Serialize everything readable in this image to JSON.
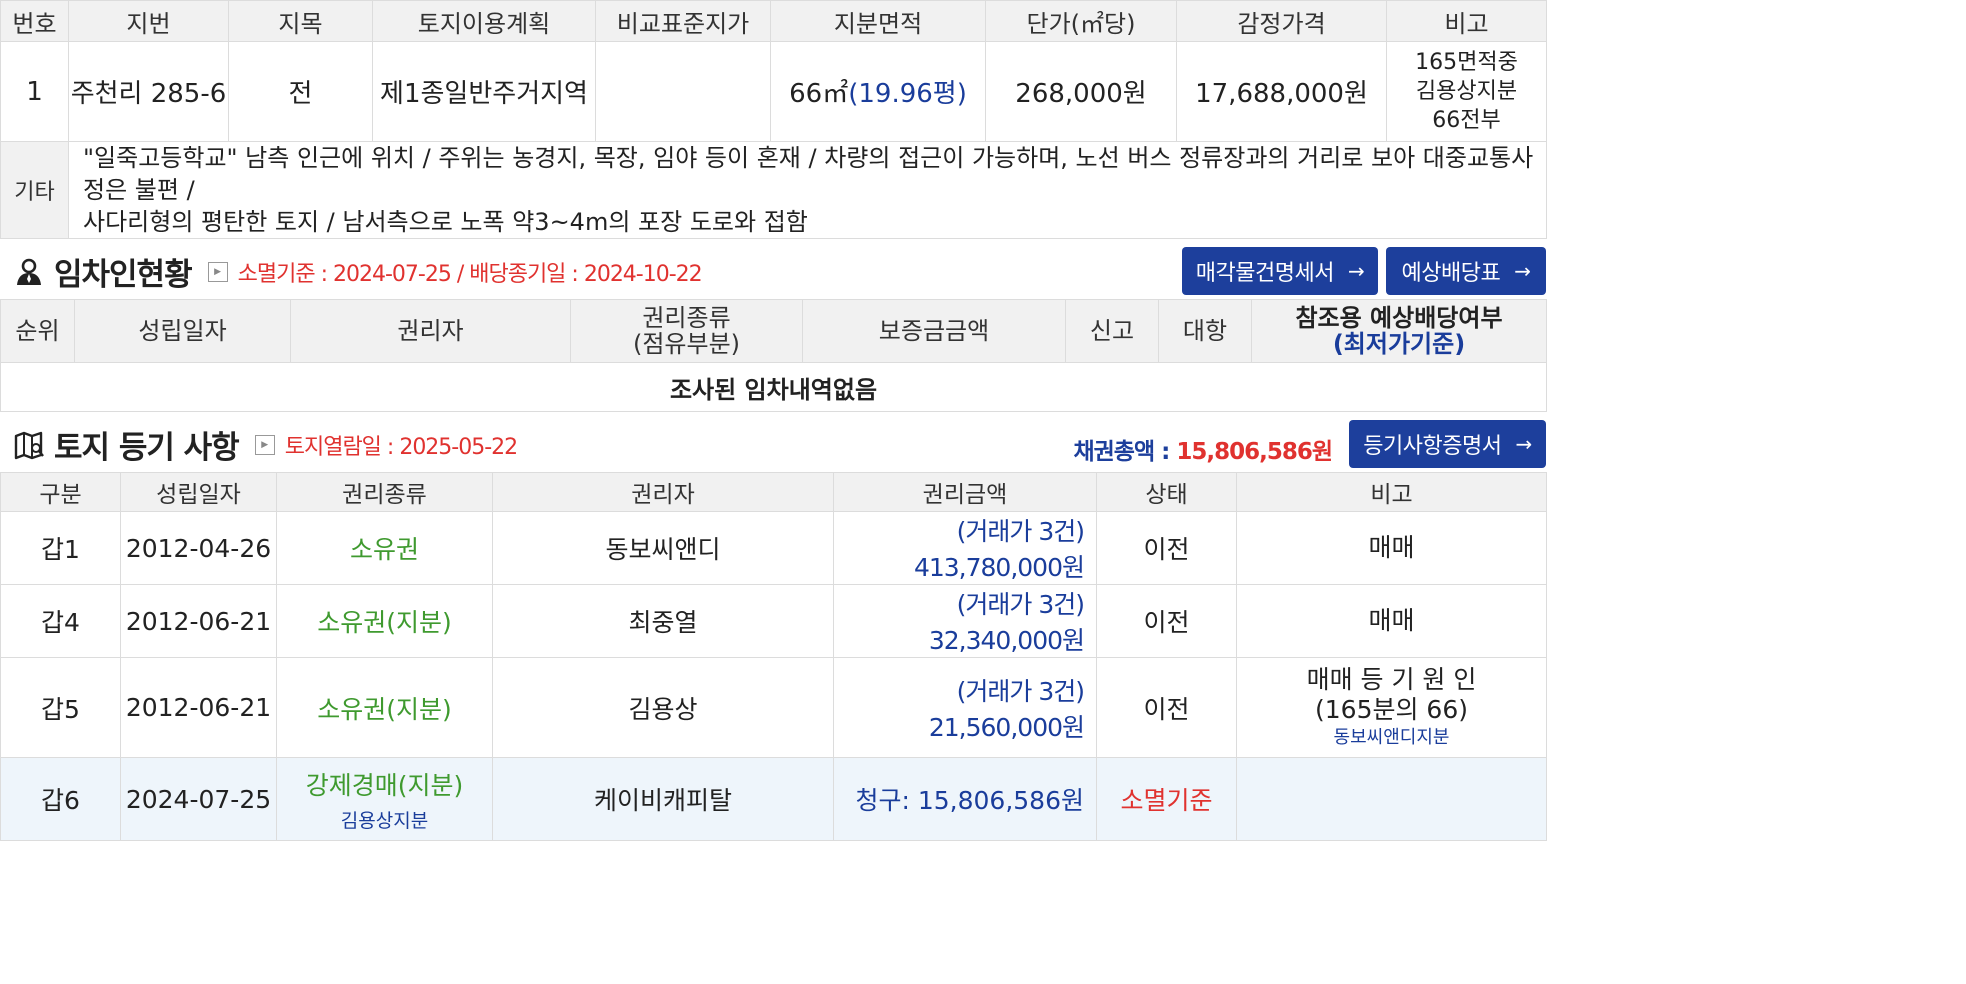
{
  "land_table": {
    "headers": [
      "번호",
      "지번",
      "지목",
      "토지이용계획",
      "비교표준지가",
      "지분면적",
      "단가(㎡당)",
      "감정가격",
      "비고"
    ],
    "row": {
      "no": "1",
      "lot": "주천리 285-6",
      "category": "전",
      "plan": "제1종일반주거지역",
      "std_price": "",
      "area": "66㎡",
      "area_pyeong": "(19.96평)",
      "unit_price": "268,000원",
      "appraisal": "17,688,000원",
      "remark_lines": [
        "165면적중",
        "김용상지분",
        "66전부"
      ]
    },
    "etc_label": "기타",
    "etc_text_1": "\"일죽고등학교\" 남측 인근에 위치 / 주위는 농경지, 목장, 임야 등이 혼재 / 차량의 접근이 가능하며, 노선 버스 정류장과의 거리로 보아 대중교통사정은 불편 /",
    "etc_text_2": "사다리형의 평탄한 토지 / 남서측으로 노폭 약3~4m의 포장 도로와 접함"
  },
  "tenant_section": {
    "title": "임차인현황",
    "note": "소멸기준 : 2024-07-25 / 배당종기일 : 2024-10-22",
    "btn_sale": "매각물건명세서",
    "btn_dividend": "예상배당표",
    "arrow": "→",
    "headers": [
      "순위",
      "성립일자",
      "권리자",
      "권리종류",
      "(점유부분)",
      "보증금금액",
      "신고",
      "대항",
      "참조용 예상배당여부",
      "(최저가기준)"
    ],
    "empty": "조사된 임차내역없음"
  },
  "registry_section": {
    "title": "토지 등기 사항",
    "note": "토지열람일 : 2025-05-22",
    "total_label": "채권총액 : ",
    "total_amount": "15,806,586원",
    "btn_cert": "등기사항증명서",
    "arrow": "→",
    "headers": [
      "구분",
      "성립일자",
      "권리종류",
      "권리자",
      "권리금액",
      "상태",
      "비고"
    ],
    "rows": [
      {
        "div": "갑1",
        "date": "2012-04-26",
        "kind": "소유권",
        "holder": "동보씨앤디",
        "amount": "(거래가 3건) 413,780,000원",
        "status": "이전",
        "remark": "매매"
      },
      {
        "div": "갑4",
        "date": "2012-06-21",
        "kind": "소유권(지분)",
        "holder": "최중열",
        "amount": "(거래가 3건) 32,340,000원",
        "status": "이전",
        "remark": "매매"
      },
      {
        "div": "갑5",
        "date": "2012-06-21",
        "kind": "소유권(지분)",
        "holder": "김용상",
        "amount": "(거래가 3건) 21,560,000원",
        "status": "이전",
        "remark_1": "매매 등 기 원 인",
        "remark_2": "(165분의 66)",
        "remark_3": "동보씨앤디지분"
      },
      {
        "div": "갑6",
        "date": "2024-07-25",
        "kind": "강제경매(지분)",
        "kind_sub": "김용상지분",
        "holder": "케이비캐피탈",
        "amount": "청구: 15,806,586원",
        "status": "소멸기준",
        "remark": ""
      }
    ]
  }
}
